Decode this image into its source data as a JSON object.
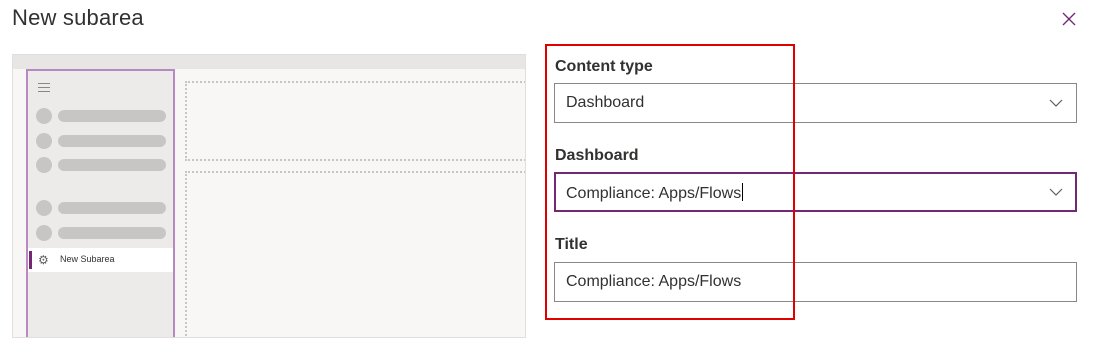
{
  "dialog": {
    "title": "New subarea",
    "close_icon": "close-icon"
  },
  "preview": {
    "nav_item_label": "New Subarea",
    "nav_item_icon": "gear-icon",
    "accent_color": "#742774"
  },
  "form": {
    "content_type": {
      "label": "Content type",
      "value": "Dashboard"
    },
    "dashboard": {
      "label": "Dashboard",
      "value": "Compliance: Apps/Flows"
    },
    "title": {
      "label": "Title",
      "value": "Compliance: Apps/Flows"
    }
  },
  "colors": {
    "highlight": "#e00000",
    "focus_border": "#742774",
    "text": "#323130"
  }
}
